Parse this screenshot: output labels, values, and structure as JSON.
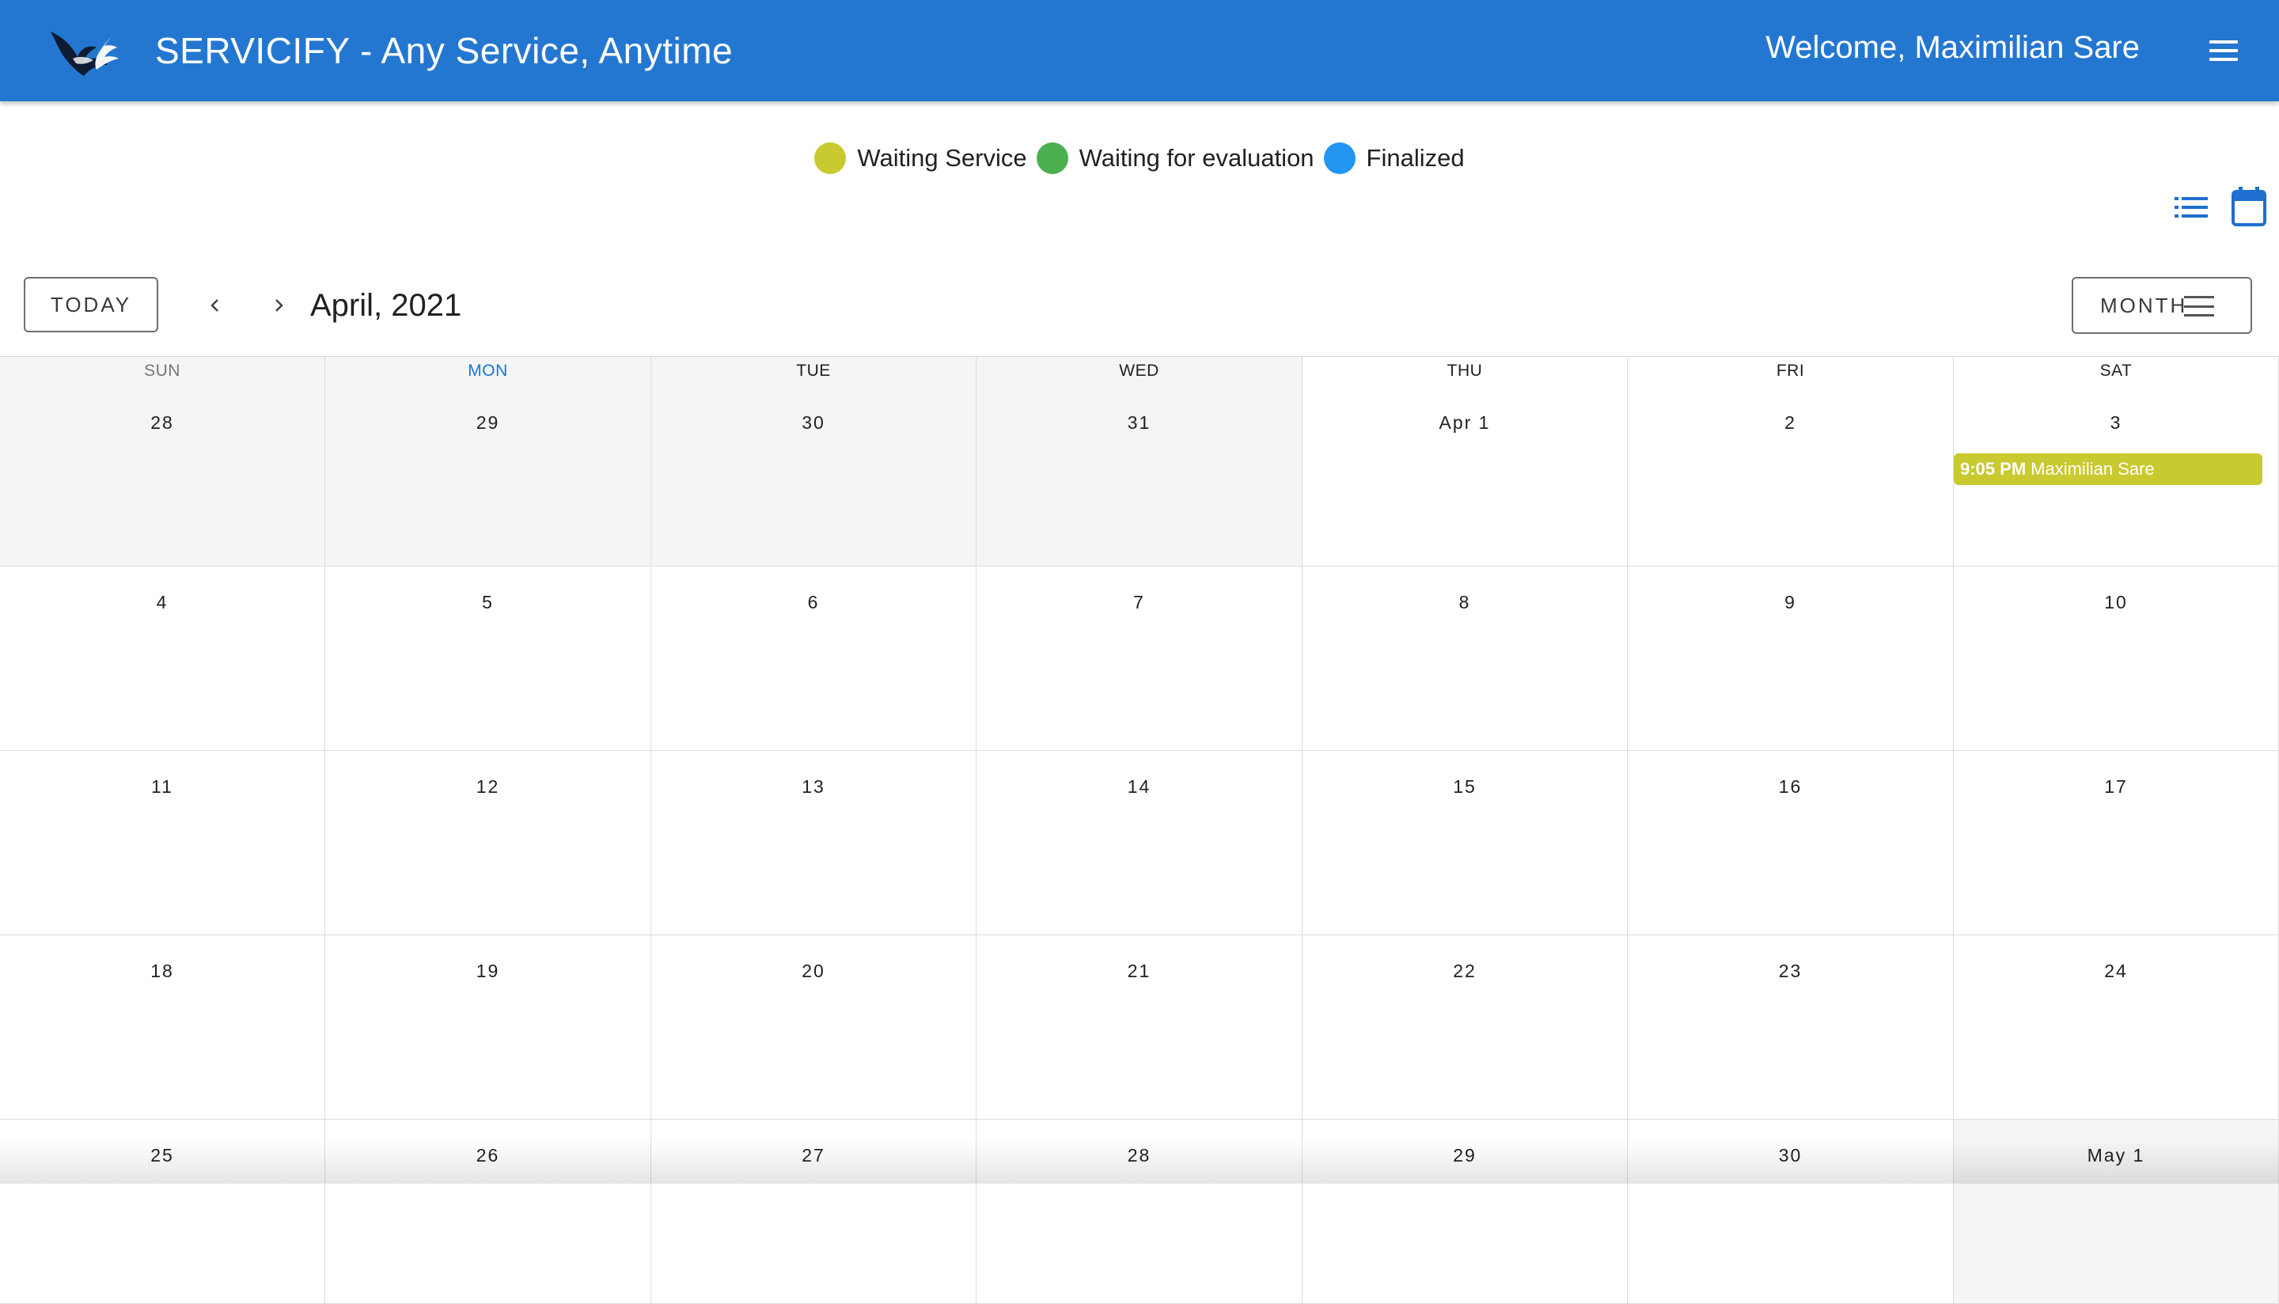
{
  "header": {
    "title": "SERVICIFY - Any Service, Anytime",
    "welcome": "Welcome, Maximilian Sare",
    "brand_color": "#2477d1"
  },
  "legend": [
    {
      "label": "Waiting Service",
      "color": "#c9c930"
    },
    {
      "label": "Waiting for evaluation",
      "color": "#4caf50"
    },
    {
      "label": "Finalized",
      "color": "#2196f3"
    }
  ],
  "toolbar": {
    "today_label": "TODAY",
    "prev_icon": "chevron-left-icon",
    "next_icon": "chevron-right-icon",
    "month_title": "April, 2021",
    "view_label": "MONTH"
  },
  "calendar": {
    "weekdays": [
      "SUN",
      "MON",
      "TUE",
      "WED",
      "THU",
      "FRI",
      "SAT"
    ],
    "weeks": [
      [
        "28",
        "29",
        "30",
        "31",
        "Apr 1",
        "2",
        "3"
      ],
      [
        "4",
        "5",
        "6",
        "7",
        "8",
        "9",
        "10"
      ],
      [
        "11",
        "12",
        "13",
        "14",
        "15",
        "16",
        "17"
      ],
      [
        "18",
        "19",
        "20",
        "21",
        "22",
        "23",
        "24"
      ],
      [
        "25",
        "26",
        "27",
        "28",
        "29",
        "30",
        "May 1"
      ]
    ],
    "events": [
      {
        "week": 0,
        "day": 6,
        "time": "9:05 PM",
        "name": "Maximilian Sare",
        "status_color": "#c9c930"
      }
    ]
  }
}
